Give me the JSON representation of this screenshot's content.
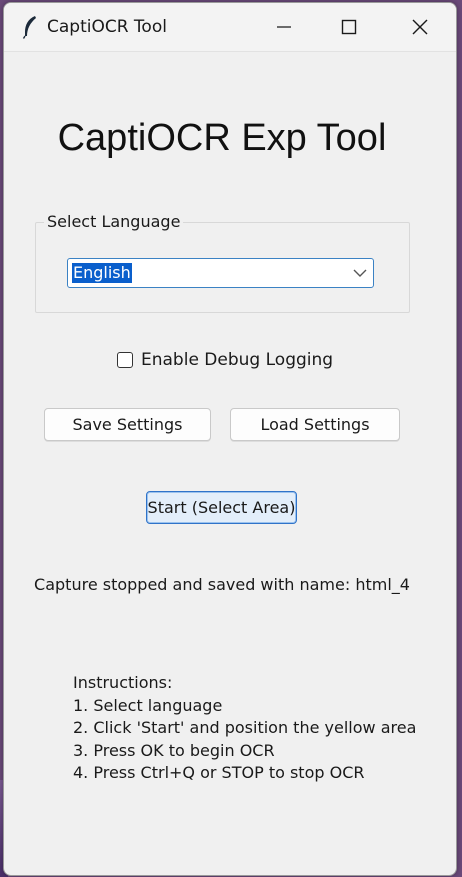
{
  "window": {
    "title": "CaptiOCR Tool",
    "icon": "feather-icon",
    "controls": [
      "minimize-icon",
      "maximize-icon",
      "close-icon"
    ]
  },
  "main": {
    "heading": "CaptiOCR Exp Tool",
    "language_group_label": "Select Language",
    "language_selected": "English",
    "debug_label": "Enable Debug Logging",
    "debug_checked": false,
    "save_label": "Save Settings",
    "load_label": "Load Settings",
    "start_label": "Start (Select Area)",
    "status": "Capture stopped and saved with name: html_4"
  },
  "instructions": {
    "title": "Instructions:",
    "steps": [
      "1. Select language",
      "2. Click 'Start' and position the yellow area",
      "3. Press OK to begin OCR",
      "4. Press Ctrl+Q or STOP to stop OCR"
    ]
  },
  "colors": {
    "selection": "#0a5fcc",
    "focus_border": "#3b82c4",
    "start_button_bg": "#e3eefa"
  }
}
